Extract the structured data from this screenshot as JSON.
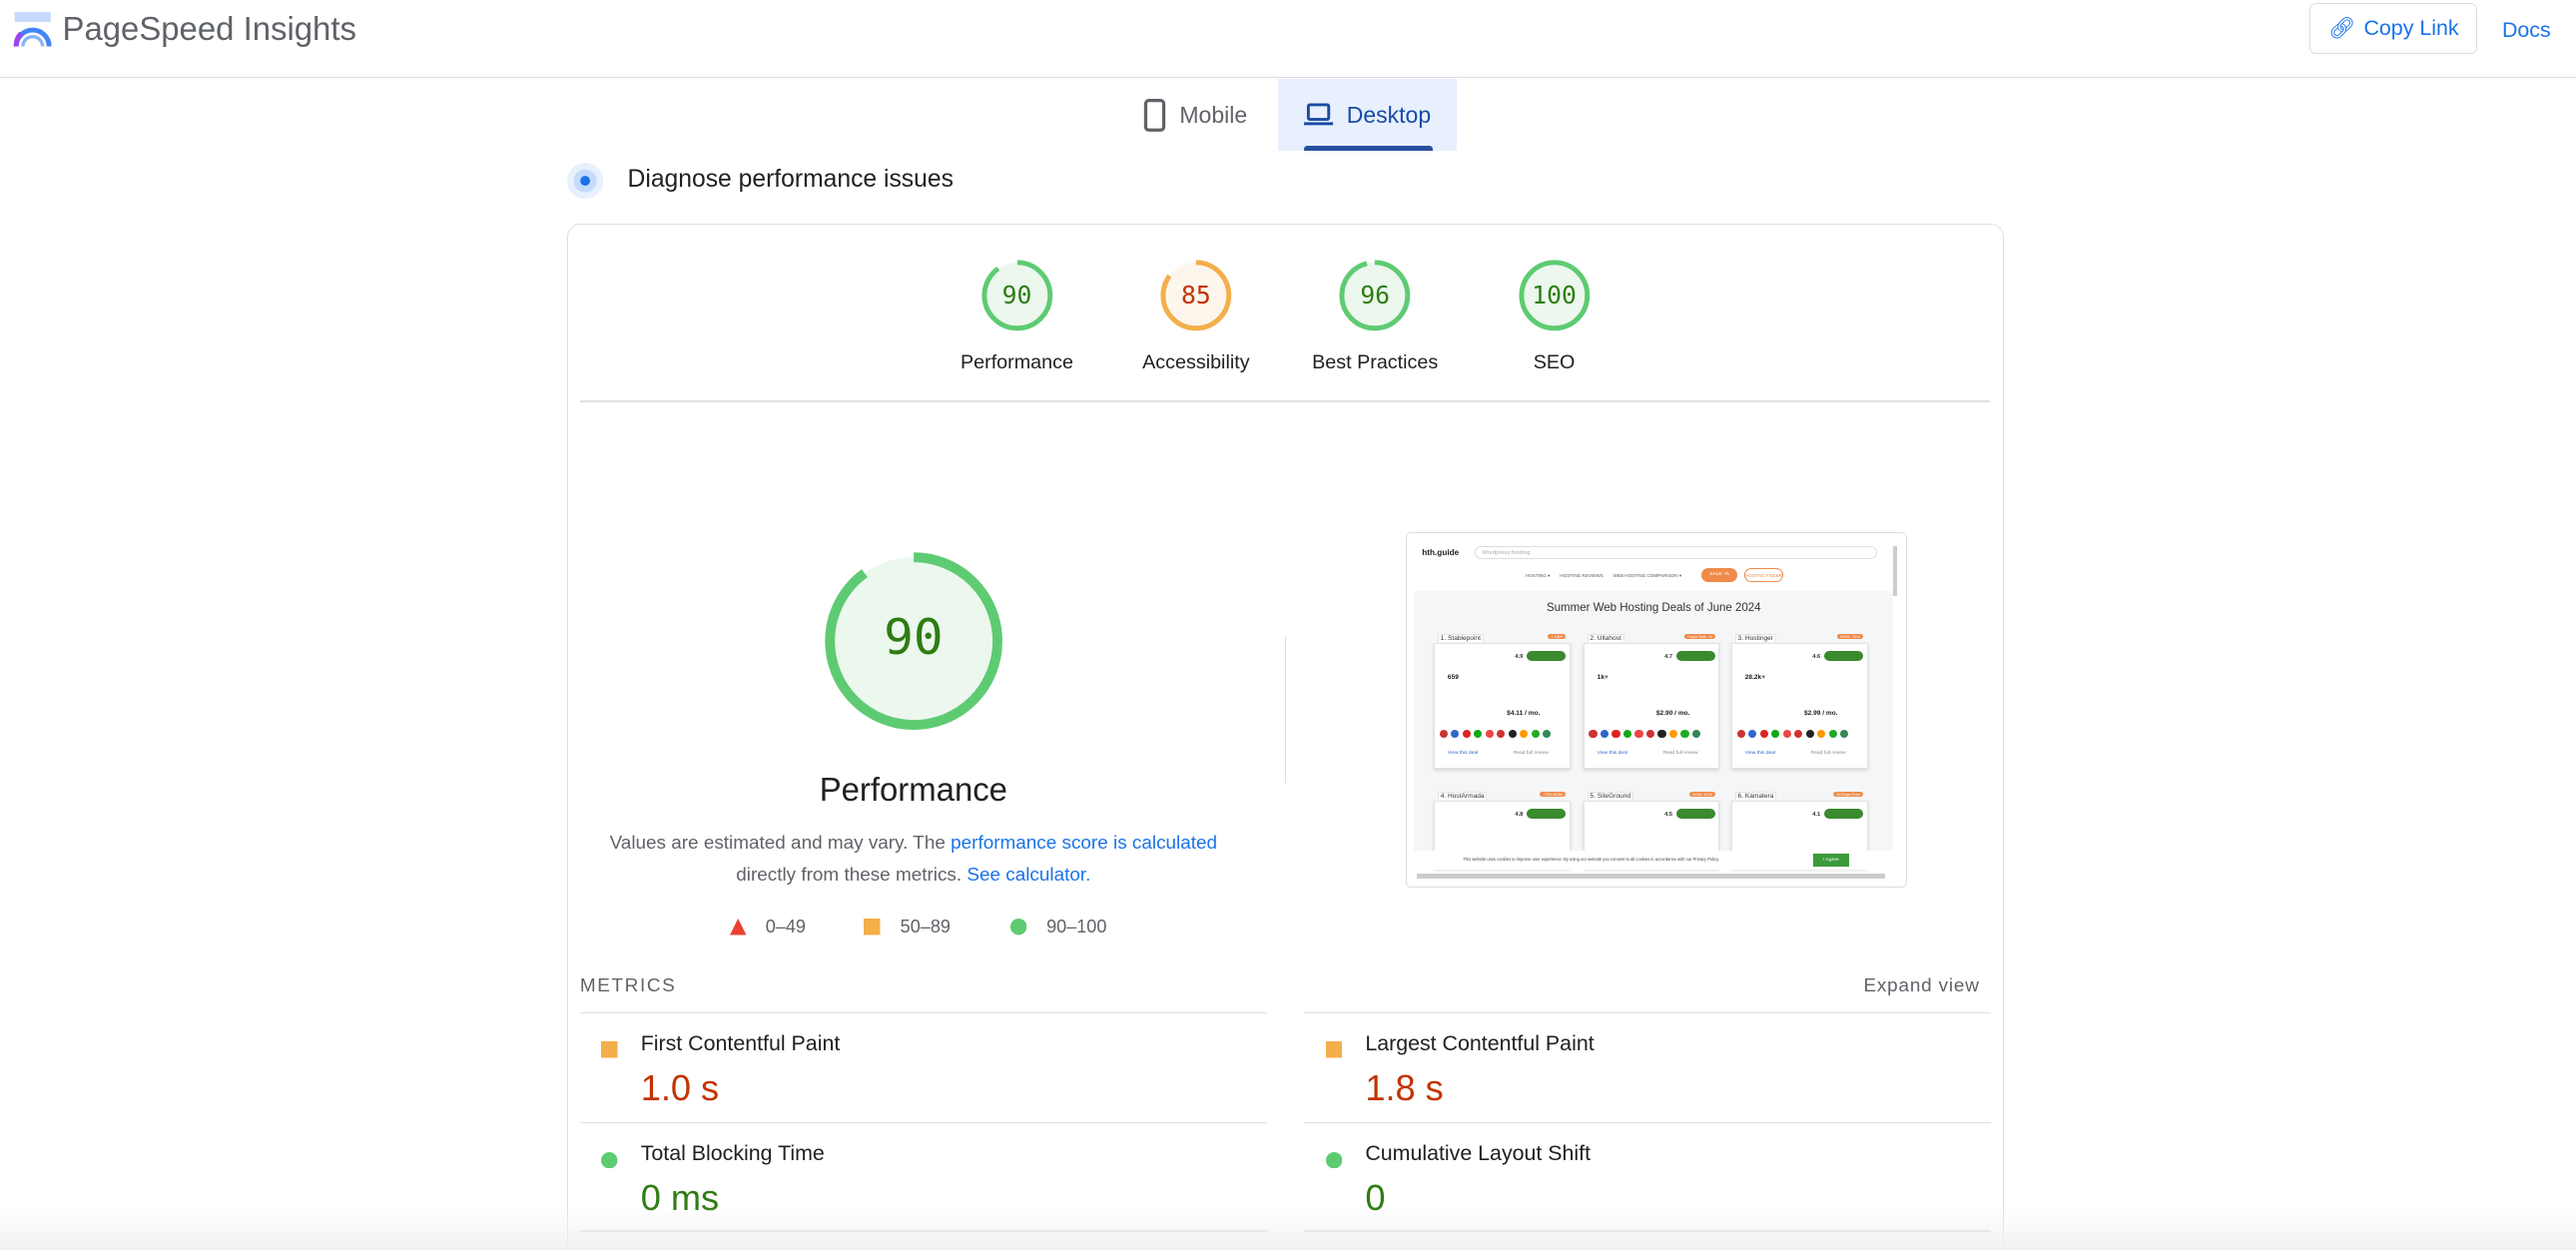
{
  "header": {
    "title": "PageSpeed Insights",
    "copy_link": "Copy Link",
    "docs": "Docs"
  },
  "tabs": [
    {
      "label": "Mobile",
      "icon": "smartphone-icon",
      "selected": false
    },
    {
      "label": "Desktop",
      "icon": "laptop-icon",
      "selected": true
    }
  ],
  "section_title": "Diagnose performance issues",
  "colors": {
    "pass": "#5ecb72",
    "average": "#f4ae4a",
    "fail": "#e94235",
    "link": "#1a73e8",
    "pass_text": "#2e7d12",
    "average_text": "#c33300"
  },
  "scores": [
    {
      "label": "Performance",
      "value": 90,
      "rating": "pass"
    },
    {
      "label": "Accessibility",
      "value": 85,
      "rating": "average"
    },
    {
      "label": "Best Practices",
      "value": 96,
      "rating": "pass"
    },
    {
      "label": "SEO",
      "value": 100,
      "rating": "pass"
    }
  ],
  "performance": {
    "score": 90,
    "label": "Performance",
    "desc_prefix": "Values are estimated and may vary. The ",
    "desc_link": "performance score is calculated",
    "desc_mid": "directly from these metrics. ",
    "desc_link2": "See calculator.",
    "legend": [
      {
        "range": "0–49",
        "shape": "triangle"
      },
      {
        "range": "50–89",
        "shape": "square"
      },
      {
        "range": "90–100",
        "shape": "circle"
      }
    ]
  },
  "metrics": {
    "heading": "METRICS",
    "expand": "Expand view",
    "items": [
      {
        "name": "First Contentful Paint",
        "value": "1.0 s",
        "rating": "average"
      },
      {
        "name": "Largest Contentful Paint",
        "value": "1.8 s",
        "rating": "average"
      },
      {
        "name": "Total Blocking Time",
        "value": "0 ms",
        "rating": "pass"
      },
      {
        "name": "Cumulative Layout Shift",
        "value": "0",
        "rating": "pass"
      }
    ]
  },
  "screenshot": {
    "logo": "hth.guide",
    "search": "Wordpress hosting",
    "nav": [
      "HOSTING ▾",
      "HOSTING REVIEWS",
      "WEB HOSTING COMPARISON ▾"
    ],
    "sale": "SALE -%",
    "finder": "HOSTING FINDER",
    "headline": "Summer Web Hosting Deals of June 2024",
    "cards": [
      {
        "name": "1. Stablepoint",
        "badge": "1 GBP",
        "rating": "4.9",
        "price": "$4.11 / mo.",
        "reviews": "659"
      },
      {
        "name": "2. Ultahost",
        "badge": "Flash Sale -%",
        "rating": "4.7",
        "price": "$2.90 / mo.",
        "reviews": "1k+"
      },
      {
        "name": "3. Hostinger",
        "badge": "NOW -75%",
        "rating": "4.6",
        "price": "$2.99 / mo.",
        "reviews": "28.2k+"
      },
      {
        "name": "4. HostArmada",
        "badge": "-75% NOW",
        "rating": "4.8"
      },
      {
        "name": "5. SiteGround",
        "badge": "NOW -81%",
        "rating": "4.5"
      },
      {
        "name": "6. Kamatera",
        "badge": "30 Days Free",
        "rating": "4.1"
      }
    ],
    "view_deal": "View this deal",
    "read_review": "Read full review",
    "cookie": "This website uses cookies to improve user experience. By using our website you consent to all cookies in accordance with our Privacy Policy.",
    "agree": "I Agree"
  }
}
